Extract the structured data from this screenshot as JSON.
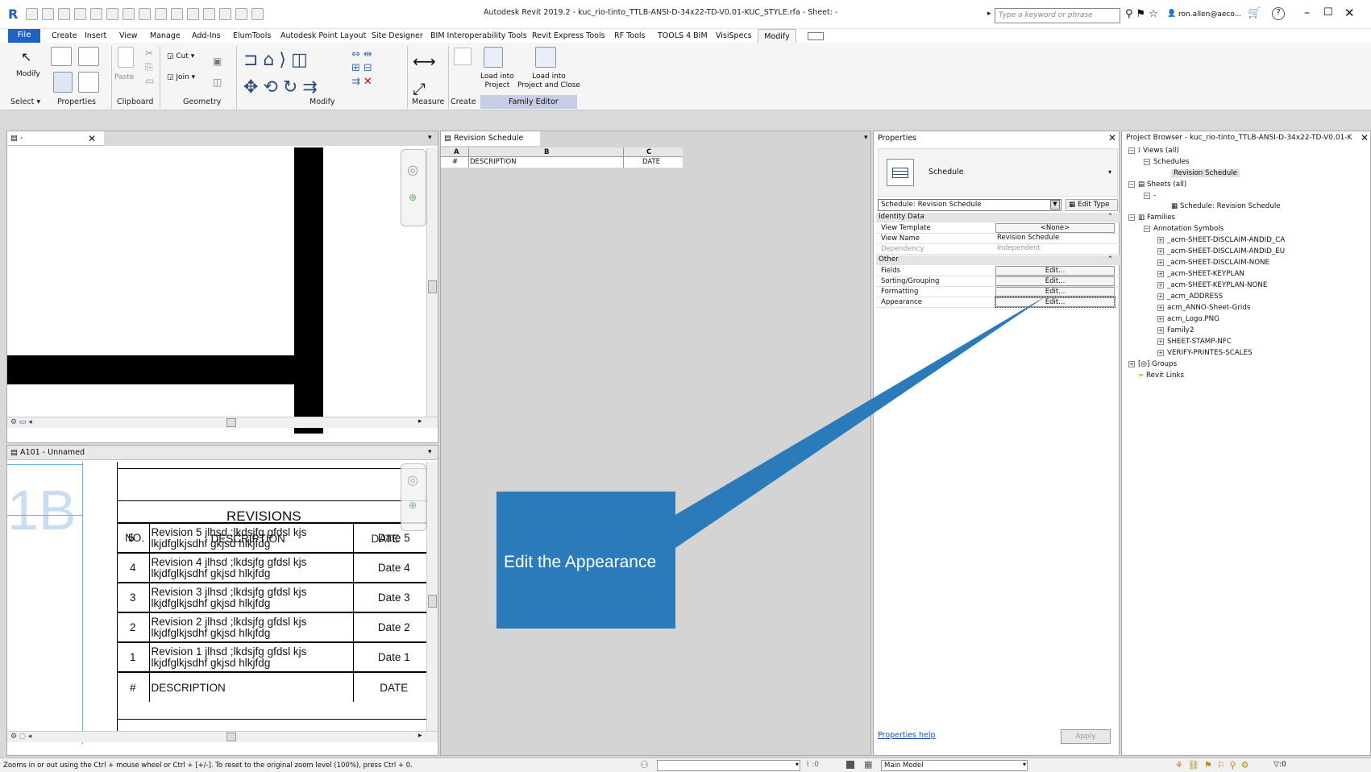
{
  "window": {
    "title": "Autodesk Revit 2019.2 - kuc_rio-tinto_TTLB-ANSI-D-34x22-TD-V0.01-KUC_STYLE.rfa - Sheet: -",
    "search_placeholder": "Type a keyword or phrase",
    "user": "ron.allen@aeco...",
    "help": "?"
  },
  "menubar": {
    "file": "File",
    "items": [
      "Create",
      "Insert",
      "View",
      "Manage",
      "Add-Ins",
      "ElumTools",
      "Autodesk Point Layout",
      "Site Designer",
      "BIM Interoperability Tools",
      "Revit Express Tools",
      "RF Tools",
      "TOOLS 4 BIM",
      "VisiSpecs"
    ],
    "active": "Modify"
  },
  "ribbon": {
    "modify": "Modify",
    "paste": "Paste",
    "cut": "Cut",
    "join": "Join",
    "load_project": "Load into\nProject",
    "load_project_close": "Load into\nProject and Close",
    "panels": {
      "select": "Select",
      "properties": "Properties",
      "clipboard": "Clipboard",
      "geometry": "Geometry",
      "modify": "Modify",
      "measure": "Measure",
      "create": "Create",
      "family_editor": "Family Editor"
    }
  },
  "view_sheet": {
    "title": "-"
  },
  "view_a101": {
    "title": "A101 - Unnamed",
    "big_label": "1B",
    "revisions_title": "REVISIONS",
    "header": {
      "no": "NO.",
      "desc": "DESCRIPTION",
      "date": "DATE"
    },
    "rows": [
      {
        "no": "5",
        "desc": "Revision 5 jlhsd ;lkdsjfg gfdsl kjs lkjdfglkjsdhf gkjsd hlkjfdg",
        "date": "Date 5"
      },
      {
        "no": "4",
        "desc": "Revision 4 jlhsd ;lkdsjfg gfdsl kjs lkjdfglkjsdhf gkjsd hlkjfdg",
        "date": "Date 4"
      },
      {
        "no": "3",
        "desc": "Revision 3 jlhsd ;lkdsjfg gfdsl kjs lkjdfglkjsdhf gkjsd hlkjfdg",
        "date": "Date 3"
      },
      {
        "no": "2",
        "desc": "Revision 2 jlhsd ;lkdsjfg gfdsl kjs lkjdfglkjsdhf gkjsd hlkjfdg",
        "date": "Date 2"
      },
      {
        "no": "1",
        "desc": "Revision 1 jlhsd ;lkdsjfg gfdsl kjs lkjdfglkjsdhf gkjsd hlkjfdg",
        "date": "Date 1"
      }
    ],
    "footer": {
      "no": "#",
      "desc": "DESCRIPTION",
      "date": "DATE"
    }
  },
  "schedule_view": {
    "tab": "Revision Schedule",
    "columns": [
      "A",
      "B",
      "C"
    ],
    "row": [
      "#",
      "DESCRIPTION",
      "DATE"
    ]
  },
  "properties": {
    "title": "Properties",
    "type_name": "Schedule",
    "selector": "Schedule: Revision Schedule",
    "edit_type": "Edit Type",
    "groups": {
      "identity": "Identity Data",
      "other": "Other"
    },
    "identity_rows": [
      {
        "key": "View Template",
        "value": "<None>"
      },
      {
        "key": "View Name",
        "value": "Revision Schedule"
      },
      {
        "key": "Dependency",
        "value": "Independent"
      }
    ],
    "other_rows": [
      {
        "key": "Fields",
        "value": "Edit..."
      },
      {
        "key": "Sorting/Grouping",
        "value": "Edit..."
      },
      {
        "key": "Formatting",
        "value": "Edit..."
      },
      {
        "key": "Appearance",
        "value": "Edit..."
      }
    ],
    "help_link": "Properties help",
    "apply": "Apply"
  },
  "project_browser": {
    "title": "Project Browser - kuc_rio-tinto_TTLB-ANSI-D-34x22-TD-V0.01-K...",
    "views": "Views (all)",
    "schedules": "Schedules",
    "revision_schedule": "Revision Schedule",
    "sheets": "Sheets (all)",
    "sheet_dash": "-",
    "sheet_schedule": "Schedule: Revision Schedule",
    "families": "Families",
    "annotation_symbols": "Annotation Symbols",
    "family_items": [
      "_acm-SHEET-DISCLAIM-ANDID_CA",
      "_acm-SHEET-DISCLAIM-ANDID_EU",
      "_acm-SHEET-DISCLAIM-NONE",
      "_acm-SHEET-KEYPLAN",
      "_acm-SHEET-KEYPLAN-NONE",
      "_acm_ADDRESS",
      "acm_ANNO-Sheet-Grids",
      "acm_Logo.PNG",
      "Family2",
      "SHEET-STAMP-NFC",
      "VERIFY-PRINTES-SCALES"
    ],
    "groups": "Groups",
    "revit_links": "Revit Links"
  },
  "status": {
    "hint": "Zooms in or out using the Ctrl + mouse wheel or Ctrl + [+/-]. To reset to the original zoom level (100%), press Ctrl + 0.",
    "zero": ":0",
    "model": "Main Model",
    "filter_count": ":0"
  },
  "callout": {
    "text": "Edit the Appearance"
  },
  "colors": {
    "accent": "#2b7bba",
    "file_tab": "#2062c4"
  }
}
